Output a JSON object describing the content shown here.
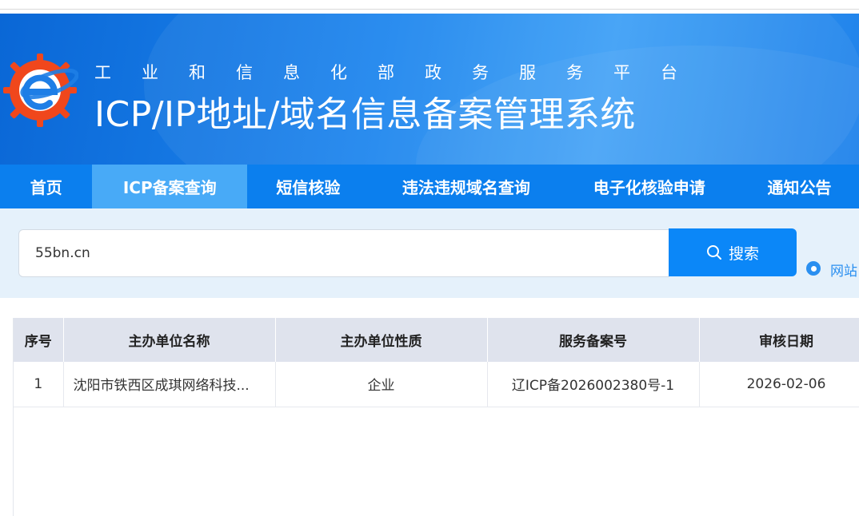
{
  "banner": {
    "subtitle": "工业和信息化部政务服务平台",
    "title": "ICP/IP地址/域名信息备案管理系统"
  },
  "nav": {
    "items": [
      {
        "label": "首页",
        "active": false
      },
      {
        "label": "ICP备案查询",
        "active": true
      },
      {
        "label": "短信核验",
        "active": false
      },
      {
        "label": "违法违规域名查询",
        "active": false
      },
      {
        "label": "电子化核验申请",
        "active": false
      },
      {
        "label": "通知公告",
        "active": false
      }
    ]
  },
  "search": {
    "value": "55bn.cn",
    "button_label": "搜索",
    "button_icon": "search-icon",
    "radio_label": "网站"
  },
  "table": {
    "headers": [
      "序号",
      "主办单位名称",
      "主办单位性质",
      "服务备案号",
      "审核日期"
    ],
    "rows": [
      [
        "1",
        "沈阳市铁西区成琪网络科技...",
        "企业",
        "辽ICP备2026002380号-1",
        "2026-02-06"
      ]
    ]
  },
  "colors": {
    "nav_bg": "#0b7fee",
    "nav_active": "#48aaf7",
    "search_button": "#0b87f8",
    "search_zone_bg": "#e5f1fb",
    "table_header_bg": "#dfe3ed"
  }
}
